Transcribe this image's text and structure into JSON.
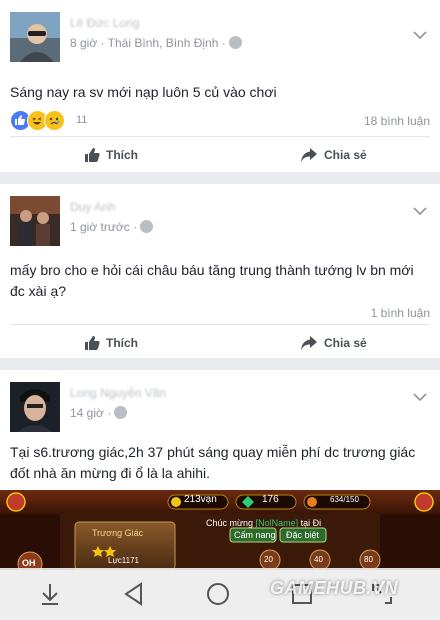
{
  "posts": [
    {
      "author": "Lê Đức Long",
      "time": "8 giờ",
      "location": "Thái Bình, Bình Định",
      "text": "Sáng nay ra sv mới nạp luôn 5 củ vào chơi",
      "reaction_count": "11",
      "comments": "18 bình luận",
      "like_label": "Thích",
      "share_label": "Chia sẻ"
    },
    {
      "author": "Duy Anh",
      "time": "1 giờ trước",
      "text": "mấy bro cho e hỏi cái châu báu tăng trung thành tướng lv bn mới đc xài ạ?",
      "comments": "1 bình luận",
      "like_label": "Thích",
      "share_label": "Chia sẻ"
    },
    {
      "author": "Long Nguyễn Văn",
      "time": "14 giờ",
      "text": "Tại s6.trương giác,2h 37 phút sáng quay miễn phí dc trương giác đốt nhà ăn mừng đi ổ là la ahihi."
    }
  ],
  "game": {
    "gold": "213vạn",
    "gems": "176",
    "stamina": "634/150",
    "congrats": "Chúc mừng",
    "player": "[NolName]",
    "congrats_suffix": "tại Đi",
    "hero": "Trương Giác",
    "power": "Lực1171",
    "btn1": "Cấm nang",
    "btn2": "Đặc biệt",
    "num1": "20",
    "num2": "40",
    "num3": "80",
    "left": "OH"
  },
  "watermark": "GAMEHUB.VN",
  "colors": {
    "like_blue": "#4a7af6",
    "meta_gray": "#90949c",
    "bg": "#e9ebee"
  },
  "icons": [
    "thumbs-up-icon",
    "share-arrow-icon",
    "globe-icon",
    "chevron-down-icon",
    "nav-back-icon",
    "nav-home-icon",
    "nav-recent-icon"
  ]
}
